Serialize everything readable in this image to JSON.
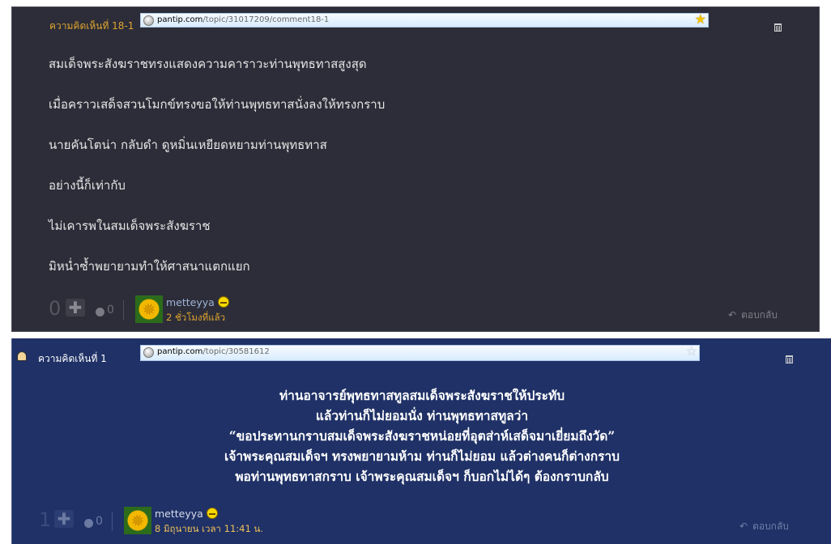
{
  "comments": [
    {
      "label": "ความคิดเห็นที่ 18-1",
      "url_domain": "pantip.com",
      "url_path": "/topic/31017209/comment18-1",
      "star": "★",
      "lines": [
        "สมเด็จพระสังฆราชทรงแสดงความคาราวะท่านพุทธทาสสูงสุด",
        "เมื่อคราวเสด็จสวนโมกข์ทรงขอให้ท่านพุทธทาสนั่งลงให้ทรงกราบ",
        "นายคันโตน่า  กลับดำ  ดูหมิ่นเหยียดหยามท่านพุทธทาส",
        "อย่างนี้ก็เท่ากับ",
        "ไม่เคารพในสมเด็จพระสังฆราช",
        "มิหน่ำซ้ำพยายามทำให้ศาสนาแตกแยก"
      ],
      "score": "0",
      "plus": "✚",
      "emotion_count": "0",
      "username": "metteyya",
      "time": "2 ชั่วโมงที่แล้ว",
      "reply": "ตอบกลับ",
      "reply_icon": "↶"
    },
    {
      "label": "ความคิดเห็นที่ 1",
      "url_domain": "pantip.com",
      "url_path": "/topic/30581612",
      "star": "☆",
      "lines": [
        "ท่านอาจารย์พุทธทาสทูลสมเด็จพระสังฆราชให้ประทับ",
        "แล้วท่านก็ไม่ยอมนั่ง ท่านพุทธทาสทูลว่า",
        "“ขอประทานกราบสมเด็จพระสังฆราชหน่อยที่อุตส่าห์เสด็จมาเยี่ยมถึงวัด”",
        "เจ้าพระคุณสมเด็จฯ ทรงพยายามห้าม ท่านก็ไม่ยอม แล้วต่างคนก็ต่างกราบ",
        "พอท่านพุทธทาสกราบ เจ้าพระคุณสมเด็จฯ ก็บอกไม่ได้ๆ ต้องกราบกลับ"
      ],
      "score": "1",
      "plus": "✚",
      "emotion_count": "0",
      "username": "metteyya",
      "time": "8 มิถุนายน เวลา 11:41 น.",
      "reply": "ตอบกลับ",
      "reply_icon": "↶"
    }
  ],
  "colors": {
    "dark_bg": "#2c2d38",
    "blue_bg": "#1f3166",
    "label_orange": "#e0a42f",
    "username": "#9fb3d6"
  },
  "icons": {
    "globe": "globe-icon",
    "star": "star-icon",
    "trash": "trash-icon",
    "plus": "plus-icon",
    "emotion": "emotion-icon",
    "reply": "reply-icon",
    "smiley": "smiley-icon",
    "profile": "profile-icon"
  }
}
